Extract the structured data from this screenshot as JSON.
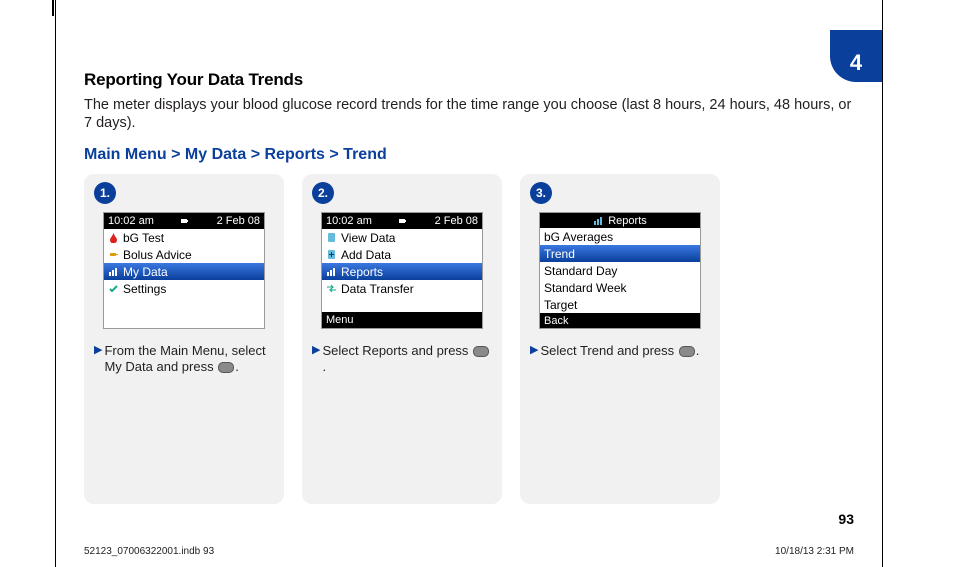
{
  "chapter": "4",
  "page_number": "93",
  "footer": {
    "left": "52123_07006322001.indb   93",
    "right": "10/18/13   2:31 PM"
  },
  "section_title": "Reporting Your Data Trends",
  "intro": "The meter displays your blood glucose record trends for the time range you choose (last 8 hours, 24 hours, 48 hours, or 7 days).",
  "breadcrumb": "Main Menu > My Data > Reports > Trend",
  "bullet_glyph": "▶",
  "steps": [
    {
      "num": "1.",
      "screen": {
        "type": "main",
        "status": {
          "time": "10:02 am",
          "date": "2 Feb 08"
        },
        "items": [
          {
            "icon": "drop",
            "label": "bG Test",
            "selected": false
          },
          {
            "icon": "syringe",
            "label": "Bolus Advice",
            "selected": false
          },
          {
            "icon": "chart",
            "label": "My Data",
            "selected": true
          },
          {
            "icon": "check",
            "label": "Settings",
            "selected": false
          }
        ]
      },
      "caption_before": "From the Main Menu, select My Data and press ",
      "caption_after": "."
    },
    {
      "num": "2.",
      "screen": {
        "type": "submenu",
        "status": {
          "time": "10:02 am",
          "date": "2 Feb 08"
        },
        "items": [
          {
            "icon": "page",
            "label": "View Data",
            "selected": false
          },
          {
            "icon": "plus",
            "label": "Add Data",
            "selected": false
          },
          {
            "icon": "chart",
            "label": "Reports",
            "selected": true
          },
          {
            "icon": "transfer",
            "label": "Data Transfer",
            "selected": false
          }
        ],
        "softkey": "Menu"
      },
      "caption_before": "Select Reports and press ",
      "caption_after": "."
    },
    {
      "num": "3.",
      "screen": {
        "type": "reports",
        "title": "Reports",
        "items": [
          {
            "label": "bG Averages",
            "selected": false
          },
          {
            "label": "Trend",
            "selected": true
          },
          {
            "label": "Standard Day",
            "selected": false
          },
          {
            "label": "Standard Week",
            "selected": false
          },
          {
            "label": "Target",
            "selected": false
          }
        ],
        "softkey": "Back"
      },
      "caption_before": "Select Trend and press ",
      "caption_after": "."
    }
  ]
}
